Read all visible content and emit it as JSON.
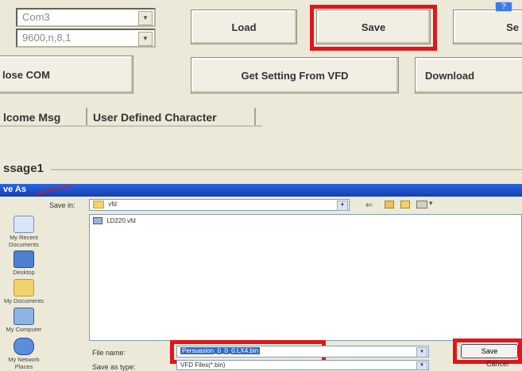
{
  "top": {
    "port_combo": "Com3",
    "baud_combo": "9600,n,8,1",
    "buttons": {
      "load": "Load",
      "save": "Save",
      "partial_right": "Se",
      "close_com": "lose COM",
      "get_setting": "Get Setting From VFD",
      "download": "Download"
    },
    "tabs": [
      "lcome Msg",
      "User Defined Character"
    ],
    "group_label": "ssage1"
  },
  "dialog": {
    "title": "ve As",
    "help_btn": "?",
    "save_in_label": "Save in:",
    "save_in_value": "vfd",
    "files": [
      "LD220.vfd"
    ],
    "places": [
      "My Recent Documents",
      "Desktop",
      "My Documents",
      "My Computer",
      "My Network Places"
    ],
    "file_name_label": "File name:",
    "file_name_value": "Persuasion_0_0_0.LX4.bin",
    "save_as_type_label": "Save as type:",
    "save_as_type_value": "VFD Files(*.bin)",
    "save_btn": "Save",
    "cancel_btn": "Cancel"
  },
  "colors": {
    "highlight_red": "#e0161b",
    "title_blue": "#1b4fc9",
    "selection_blue": "#316ac5"
  }
}
